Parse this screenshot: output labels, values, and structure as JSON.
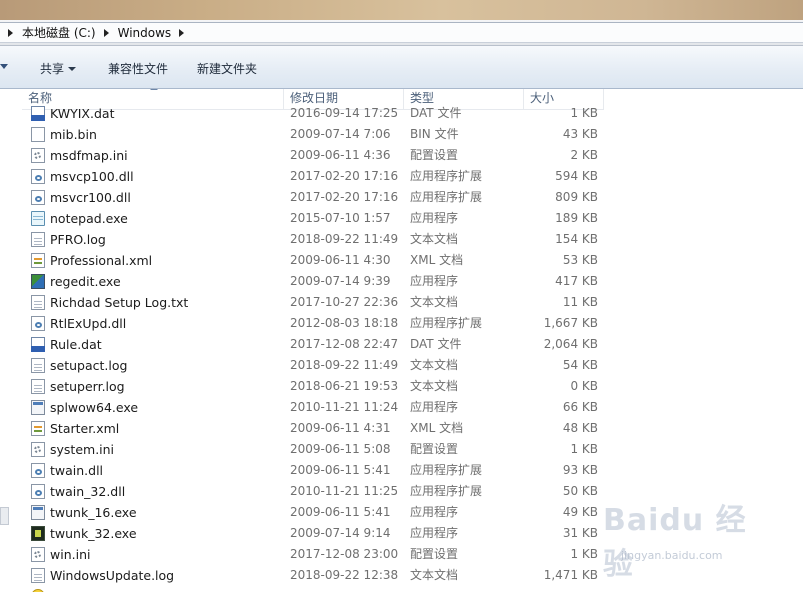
{
  "address": {
    "crumbs": [
      "本地磁盘 (C:)",
      "Windows"
    ]
  },
  "toolbar": {
    "share_label": "共享",
    "compat_label": "兼容性文件",
    "new_folder_label": "新建文件夹"
  },
  "columns": {
    "name": "名称",
    "date": "修改日期",
    "type": "类型",
    "size": "大小"
  },
  "files": [
    {
      "name": "KWYIX.dat",
      "date": "2016-09-14 17:25",
      "type": "DAT 文件",
      "size": "1 KB",
      "icon": "dat-file-icon"
    },
    {
      "name": "mib.bin",
      "date": "2009-07-14 7:06",
      "type": "BIN 文件",
      "size": "43 KB",
      "icon": "bin-file-icon"
    },
    {
      "name": "msdfmap.ini",
      "date": "2009-06-11 4:36",
      "type": "配置设置",
      "size": "2 KB",
      "icon": "ini-file-icon"
    },
    {
      "name": "msvcp100.dll",
      "date": "2017-02-20 17:16",
      "type": "应用程序扩展",
      "size": "594 KB",
      "icon": "dll-file-icon"
    },
    {
      "name": "msvcr100.dll",
      "date": "2017-02-20 17:16",
      "type": "应用程序扩展",
      "size": "809 KB",
      "icon": "dll-file-icon"
    },
    {
      "name": "notepad.exe",
      "date": "2015-07-10 1:57",
      "type": "应用程序",
      "size": "189 KB",
      "icon": "notepad-icon"
    },
    {
      "name": "PFRO.log",
      "date": "2018-09-22 11:49",
      "type": "文本文档",
      "size": "154 KB",
      "icon": "text-file-icon"
    },
    {
      "name": "Professional.xml",
      "date": "2009-06-11 4:30",
      "type": "XML 文档",
      "size": "53 KB",
      "icon": "xml-file-icon"
    },
    {
      "name": "regedit.exe",
      "date": "2009-07-14 9:39",
      "type": "应用程序",
      "size": "417 KB",
      "icon": "regedit-icon"
    },
    {
      "name": "Richdad Setup Log.txt",
      "date": "2017-10-27 22:36",
      "type": "文本文档",
      "size": "11 KB",
      "icon": "text-file-icon"
    },
    {
      "name": "RtlExUpd.dll",
      "date": "2012-08-03 18:18",
      "type": "应用程序扩展",
      "size": "1,667 KB",
      "icon": "dll-file-icon"
    },
    {
      "name": "Rule.dat",
      "date": "2017-12-08 22:47",
      "type": "DAT 文件",
      "size": "2,064 KB",
      "icon": "dat-file-icon"
    },
    {
      "name": "setupact.log",
      "date": "2018-09-22 11:49",
      "type": "文本文档",
      "size": "54 KB",
      "icon": "text-file-icon"
    },
    {
      "name": "setuperr.log",
      "date": "2018-06-21 19:53",
      "type": "文本文档",
      "size": "0 KB",
      "icon": "text-file-icon"
    },
    {
      "name": "splwow64.exe",
      "date": "2010-11-21 11:24",
      "type": "应用程序",
      "size": "66 KB",
      "icon": "exe-file-icon"
    },
    {
      "name": "Starter.xml",
      "date": "2009-06-11 4:31",
      "type": "XML 文档",
      "size": "48 KB",
      "icon": "xml-file-icon"
    },
    {
      "name": "system.ini",
      "date": "2009-06-11 5:08",
      "type": "配置设置",
      "size": "1 KB",
      "icon": "ini-file-icon"
    },
    {
      "name": "twain.dll",
      "date": "2009-06-11 5:41",
      "type": "应用程序扩展",
      "size": "93 KB",
      "icon": "dll-file-icon"
    },
    {
      "name": "twain_32.dll",
      "date": "2010-11-21 11:25",
      "type": "应用程序扩展",
      "size": "50 KB",
      "icon": "dll-file-icon"
    },
    {
      "name": "twunk_16.exe",
      "date": "2009-06-11 5:41",
      "type": "应用程序",
      "size": "49 KB",
      "icon": "exe-file-icon"
    },
    {
      "name": "twunk_32.exe",
      "date": "2009-07-14 9:14",
      "type": "应用程序",
      "size": "31 KB",
      "icon": "twunk-icon"
    },
    {
      "name": "win.ini",
      "date": "2017-12-08 23:00",
      "type": "配置设置",
      "size": "1 KB",
      "icon": "ini-file-icon"
    },
    {
      "name": "WindowsUpdate.log",
      "date": "2018-09-22 12:38",
      "type": "文本文档",
      "size": "1,471 KB",
      "icon": "text-file-icon"
    },
    {
      "name": "",
      "date": "",
      "type": "",
      "size": "",
      "icon": "yellow-app-icon"
    }
  ],
  "watermark": {
    "main": "Baidu 经验",
    "sub": "jingyan.baidu.com"
  }
}
